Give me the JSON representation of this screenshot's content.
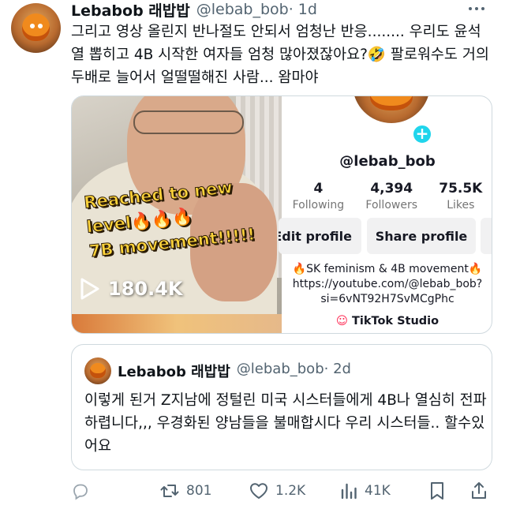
{
  "post": {
    "author_name": "Lebabob 래밥밥",
    "handle": "@lebab_bob",
    "time": "· 1d",
    "text": "그리고 영상 올린지 반나절도 안되서 엄청난 반응........ 우리도 윤석열 뽑히고 4B 시작한 여자들 엄청 많아졌잖아요?🤣 팔로워수도 거의 두배로 늘어서 얼떨떨해진 사람... 왐마야"
  },
  "media": {
    "video_overlay_lines": [
      "Reached to new",
      "level🔥🔥🔥",
      "7B movement!!!!!"
    ],
    "view_count": "180.4K",
    "profile": {
      "username": "@lebab_bob",
      "stats": [
        {
          "num": "4",
          "label": "Following"
        },
        {
          "num": "4,394",
          "label": "Followers"
        },
        {
          "num": "75.5K",
          "label": "Likes"
        }
      ],
      "edit_label": "Edit profile",
      "share_label": "Share profile",
      "bio_line1": "🔥SK feminism & 4B movement🔥",
      "bio_line2": "https://youtube.com/@lebab_bob?",
      "bio_line3": "si=6vNT92H7SvMCgPhc",
      "studio_label": "TikTok Studio",
      "plus": "+"
    }
  },
  "quote": {
    "author_name": "Lebabob 래밥밥",
    "handle": "@lebab_bob",
    "time": "· 2d",
    "text": "이렇게 된거 Z지남에 정털린 미국 시스터들에게 4B나 열심히 전파하렵니다,,, 우경화된 양남들을 불매합시다 우리 시스터들.. 할수있어요"
  },
  "actions": {
    "reply_count": "",
    "retweet_count": "801",
    "like_count": "1.2K",
    "views_count": "41K"
  },
  "icons": {
    "reply": "reply-icon",
    "retweet": "retweet-icon",
    "like": "heart-icon",
    "views": "views-icon",
    "bookmark": "bookmark-icon",
    "share": "share-icon",
    "more": "more-icon",
    "play": "play-icon"
  },
  "colors": {
    "text": "#0f1419",
    "secondary": "#536471",
    "border": "#cfd9de",
    "tiktok_cyan": "#20d5ec",
    "tiktok_red": "#fe2c55",
    "overlay_yellow": "#ffd43b"
  }
}
